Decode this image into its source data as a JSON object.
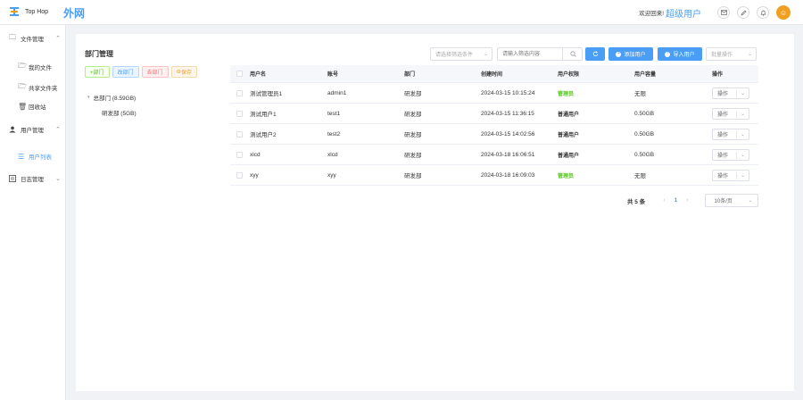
{
  "header": {
    "logo_text": "Top Hop",
    "brand_title": "外网",
    "welcome": "欢迎回来!",
    "username": "超级用户",
    "icons": [
      "mail-icon",
      "edit-icon",
      "bell-icon"
    ]
  },
  "sidebar": {
    "groups": [
      {
        "label": "文件管理",
        "icon": "folder-icon"
      },
      {
        "label": "用户管理",
        "icon": "user-icon"
      },
      {
        "label": "日志管理",
        "icon": "log-icon"
      }
    ],
    "items": [
      {
        "label": "我的文件",
        "icon": "folder-open-icon",
        "active": false
      },
      {
        "label": "共享文件夹",
        "icon": "folder-open-icon",
        "active": false
      },
      {
        "label": "回收站",
        "icon": "trash-icon",
        "active": false
      },
      {
        "label": "用户列表",
        "icon": "list-icon",
        "active": true
      }
    ]
  },
  "dept": {
    "title": "部门管理",
    "buttons": {
      "add": "+部门",
      "edit": "改部门",
      "delete": "去部门",
      "save": "保存"
    },
    "tree": {
      "root": "总部门 (8.59GB)",
      "children": [
        "研发部 (5GB)"
      ]
    }
  },
  "toolbar": {
    "filter_placeholder": "请选择筛选条件",
    "search_placeholder": "请输入筛选内容",
    "add_user": "添加用户",
    "import_user": "导入用户",
    "batch_placeholder": "批量操作"
  },
  "table": {
    "headers": [
      "用户名",
      "账号",
      "部门",
      "创建时间",
      "用户权限",
      "用户容量",
      "操作"
    ],
    "rows": [
      {
        "name": "测试管理员1",
        "account": "admin1",
        "dept": "研发部",
        "created": "2024-03-15 10:15:24",
        "perm": "管理员",
        "perm_type": "admin",
        "cap": "无限",
        "op": "操作"
      },
      {
        "name": "测试用户1",
        "account": "test1",
        "dept": "研发部",
        "created": "2024-03-15 11:36:15",
        "perm": "普通用户",
        "perm_type": "user",
        "cap": "0.50GB",
        "op": "操作"
      },
      {
        "name": "测试用户2",
        "account": "test2",
        "dept": "研发部",
        "created": "2024-03-15 14:02:56",
        "perm": "普通用户",
        "perm_type": "user",
        "cap": "0.50GB",
        "op": "操作"
      },
      {
        "name": "xlcd",
        "account": "xlcd",
        "dept": "研发部",
        "created": "2024-03-18 16:06:51",
        "perm": "普通用户",
        "perm_type": "user",
        "cap": "0.50GB",
        "op": "操作"
      },
      {
        "name": "xyy",
        "account": "xyy",
        "dept": "研发部",
        "created": "2024-03-18 16:09:03",
        "perm": "管理员",
        "perm_type": "admin",
        "cap": "无限",
        "op": "操作"
      }
    ]
  },
  "pagination": {
    "total": "共 5 条",
    "current": "1",
    "page_size": "10条/页"
  },
  "colors": {
    "primary": "#4a9ef5",
    "admin": "#52c41a",
    "avatar": "#f0a020"
  }
}
